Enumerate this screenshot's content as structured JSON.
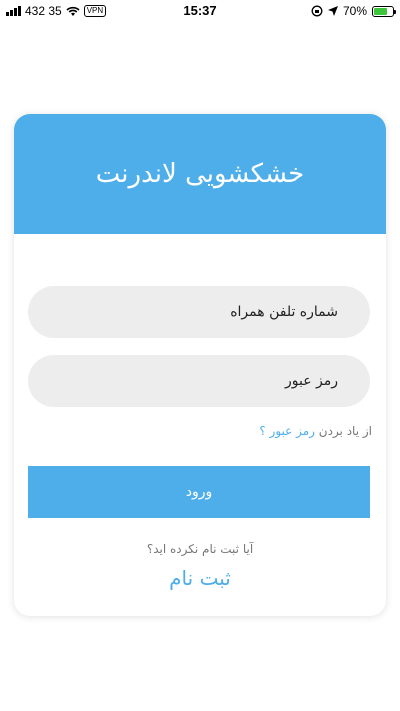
{
  "status_bar": {
    "carrier_info": "432 35",
    "vpn": "VPN",
    "time": "15:37",
    "battery_percent": "70%",
    "battery_level": 0.7,
    "icons": [
      "signal-icon",
      "wifi-icon",
      "vpn-icon",
      "lock-rotation-icon",
      "location-icon",
      "battery-icon"
    ]
  },
  "header": {
    "title": "خشکشویی لاندرنت"
  },
  "form": {
    "phone_placeholder": "شماره تلفن همراه",
    "password_placeholder": "رمز عبور",
    "forgot_prefix": "از یاد بردن ",
    "forgot_link": "رمز عبور ؟",
    "login_label": "ورود",
    "no_account_text": "آیا ثبت نام نکرده اید؟",
    "signup_label": "ثبت نام"
  },
  "colors": {
    "accent": "#4eaee9",
    "input_bg": "#ededed",
    "muted_text": "#777777"
  }
}
